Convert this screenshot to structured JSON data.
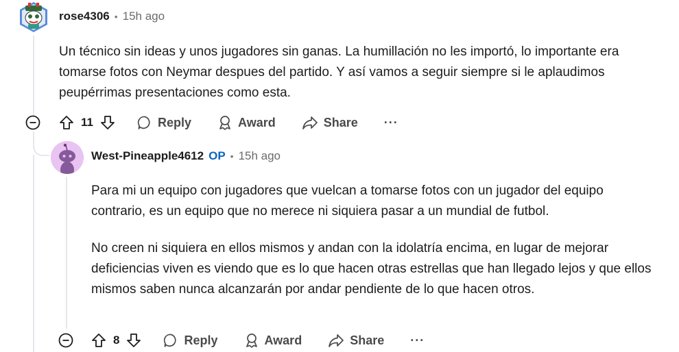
{
  "comment1": {
    "username": "rose4306",
    "time": "15h ago",
    "body": "Un técnico sin ideas y unos jugadores sin ganas. La humillación no les importó, lo importante era tomarse fotos con Neymar despues del partido. Y así vamos a seguir siempre si le aplaudimos peupérrimas presentaciones como esta.",
    "votes": "11",
    "reply_label": "Reply",
    "award_label": "Award",
    "share_label": "Share",
    "more_label": "···"
  },
  "comment2": {
    "username": "West-Pineapple4612",
    "op_label": "OP",
    "time": "15h ago",
    "paragraph1": "Para mi un equipo con jugadores que vuelcan a tomarse fotos con un jugador del equipo contrario, es un equipo que no merece ni siquiera pasar a un mundial de futbol.",
    "paragraph2": "No creen ni siquiera en ellos mismos y andan con la idolatría encima, en lugar de mejorar deficiencias viven es viendo que es lo que hacen otras estrellas que han llegado lejos y que ellos mismos saben nunca alcanzarán por andar pendiente de lo que hacen otros.",
    "votes": "8",
    "reply_label": "Reply",
    "award_label": "Award",
    "share_label": "Share",
    "more_label": "···"
  },
  "separator": "•"
}
